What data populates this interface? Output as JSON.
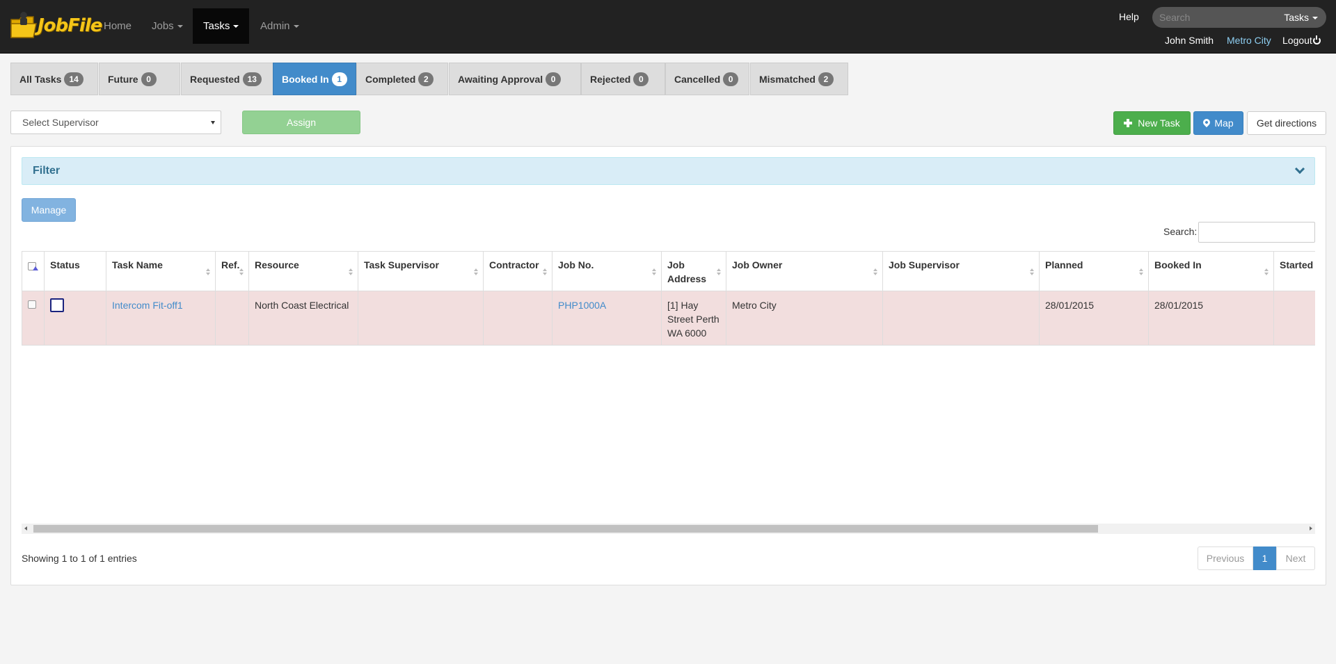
{
  "app": {
    "logo_text": "JobFile",
    "nav": [
      {
        "label": "Home",
        "dropdown": false
      },
      {
        "label": "Jobs",
        "dropdown": true
      },
      {
        "label": "Tasks",
        "dropdown": true,
        "active": true
      },
      {
        "label": "Admin",
        "dropdown": true
      }
    ],
    "help": "Help",
    "search": {
      "placeholder": "Search",
      "type": "Tasks"
    },
    "user": {
      "name": "John Smith",
      "org": "Metro City",
      "logout": "Logout"
    }
  },
  "tabs": [
    {
      "label": "All Tasks",
      "count": "14"
    },
    {
      "label": "Future",
      "count": "0"
    },
    {
      "label": "Requested",
      "count": "13"
    },
    {
      "label": "Booked In",
      "count": "1",
      "active": true
    },
    {
      "label": "Completed",
      "count": "2"
    },
    {
      "label": "Awaiting Approval",
      "count": "0"
    },
    {
      "label": "Rejected",
      "count": "0"
    },
    {
      "label": "Cancelled",
      "count": "0"
    },
    {
      "label": "Mismatched",
      "count": "2"
    }
  ],
  "toolbar": {
    "supervisor_placeholder": "Select Supervisor",
    "assign": "Assign",
    "new_task": "New Task",
    "map": "Map",
    "directions": "Get directions"
  },
  "panel": {
    "filter": "Filter",
    "manage": "Manage",
    "search_label": "Search:",
    "columns": [
      "Status",
      "Task Name",
      "Ref.",
      "Resource",
      "Task Supervisor",
      "Contractor",
      "Job No.",
      "Job Address",
      "Job Owner",
      "Job Supervisor",
      "Planned",
      "Booked In",
      "Started"
    ],
    "rows": [
      {
        "task_name": "Intercom Fit-off1",
        "ref": "",
        "resource": "North Coast Electrical",
        "task_supervisor": "",
        "contractor": "",
        "job_no": "PHP1000A",
        "job_address": "[1] Hay Street Perth WA 6000",
        "job_owner": "Metro City",
        "job_supervisor": "",
        "planned": "28/01/2015",
        "booked_in": "28/01/2015",
        "started": ""
      }
    ],
    "info": "Showing 1 to 1 of 1 entries",
    "pager": {
      "previous": "Previous",
      "current": "1",
      "next": "Next"
    }
  },
  "colors": {
    "navbar": "#222222",
    "primary": "#428bca",
    "success": "#4cae4c",
    "row_highlight": "#f2dede",
    "filter_bg": "#d9edf7"
  }
}
